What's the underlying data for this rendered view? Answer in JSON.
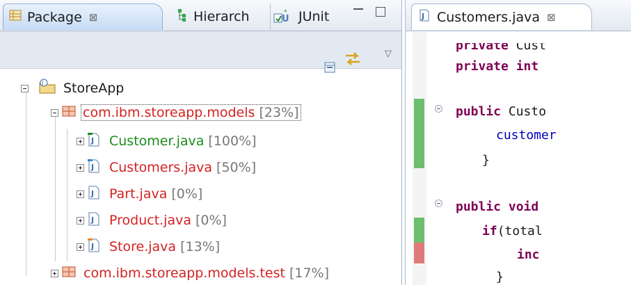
{
  "left_view": {
    "tabs": [
      {
        "label": "Package",
        "close": "⊠",
        "active": true
      },
      {
        "label": "Hierarch",
        "active": false
      },
      {
        "label": "JUnit",
        "active": false
      }
    ]
  },
  "tree": {
    "project": {
      "label": "StoreApp"
    },
    "packages": [
      {
        "name": "com.ibm.storeapp.models",
        "pct": "[23%]",
        "color": "#d32222",
        "files": [
          {
            "name": "Customer.java",
            "pct": "[100%]",
            "color": "#1a8c1a"
          },
          {
            "name": "Customers.java",
            "pct": "[50%]",
            "color": "#d32222"
          },
          {
            "name": "Part.java",
            "pct": "[0%]",
            "color": "#d32222"
          },
          {
            "name": "Product.java",
            "pct": "[0%]",
            "color": "#d32222"
          },
          {
            "name": "Store.java",
            "pct": "[13%]",
            "color": "#d32222"
          }
        ]
      },
      {
        "name": "com.ibm.storeapp.models.test",
        "pct": "[17%]",
        "color": "#d32222"
      }
    ]
  },
  "editor": {
    "tab": {
      "label": "Customers.java",
      "close": "⊠"
    },
    "code_lines": [
      {
        "kw": "private",
        "rest": " Cust"
      },
      {
        "kw": "private int",
        "rest": ""
      },
      {
        "kw": "public",
        "rest": " Custo"
      },
      {
        "kw": "",
        "rest": "customer"
      },
      {
        "kw": "",
        "rest": "}"
      },
      {
        "kw": "public void",
        "rest": ""
      },
      {
        "kw": "if",
        "rest": "(total"
      },
      {
        "kw": "",
        "rest": "inc"
      },
      {
        "kw": "",
        "rest": "}"
      }
    ],
    "coverage_colors": {
      "covered": "#6cbf6c",
      "uncovered": "#e07a7a"
    }
  }
}
